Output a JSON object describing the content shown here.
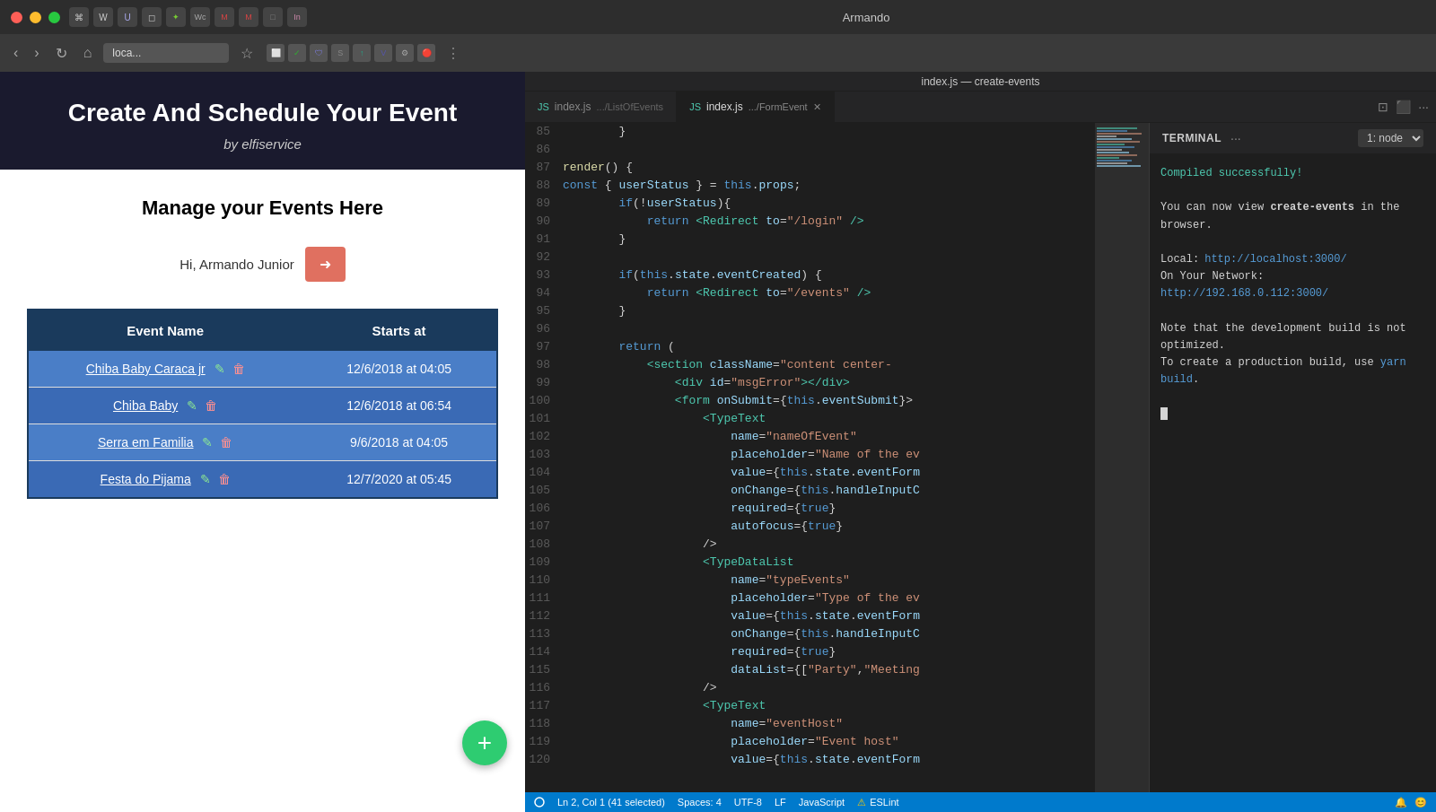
{
  "mac": {
    "titlebar_text": "Armando"
  },
  "browser": {
    "url": "loca...",
    "title": "Create And Schedule Your Event",
    "subtitle": "by elfiservice"
  },
  "app": {
    "manage_title": "Manage your Events Here",
    "user_greeting": "Hi, Armando Junior",
    "table": {
      "col_event": "Event Name",
      "col_starts": "Starts at",
      "rows": [
        {
          "name": "Chiba Baby Caraca jr",
          "starts": "12/6/2018 at 04:05"
        },
        {
          "name": "Chiba Baby",
          "starts": "12/6/2018 at 06:54"
        },
        {
          "name": "Serra em Familia",
          "starts": "9/6/2018 at 04:05"
        },
        {
          "name": "Festa do Pijama",
          "starts": "12/7/2020 at 05:45"
        }
      ]
    },
    "fab_label": "+"
  },
  "editor": {
    "window_title": "index.js — create-events",
    "tab1_label": "index.js",
    "tab1_path": ".../ListOfEvents",
    "tab2_label": "index.js",
    "tab2_path": ".../FormEvent",
    "lines": [
      {
        "num": "85",
        "code": "        }"
      },
      {
        "num": "86",
        "code": ""
      },
      {
        "num": "87",
        "code": "    render() {"
      },
      {
        "num": "88",
        "code": "        const { userStatus } = this.props;"
      },
      {
        "num": "89",
        "code": "        if(!userStatus){"
      },
      {
        "num": "90",
        "code": "            return <Redirect to=\"/login\" />"
      },
      {
        "num": "91",
        "code": "        }"
      },
      {
        "num": "92",
        "code": ""
      },
      {
        "num": "93",
        "code": "        if(this.state.eventCreated) {"
      },
      {
        "num": "94",
        "code": "            return <Redirect to=\"/events\" />"
      },
      {
        "num": "95",
        "code": "        }"
      },
      {
        "num": "96",
        "code": ""
      },
      {
        "num": "97",
        "code": "        return ("
      },
      {
        "num": "98",
        "code": "            <section className=\"content center-"
      },
      {
        "num": "99",
        "code": "                <div id=\"msgError\"></div>"
      },
      {
        "num": "100",
        "code": "                <form onSubmit={this.eventSubmit}>"
      },
      {
        "num": "101",
        "code": "                    <TypeText"
      },
      {
        "num": "102",
        "code": "                        name=\"nameOfEvent\""
      },
      {
        "num": "103",
        "code": "                        placeholder=\"Name of the ev"
      },
      {
        "num": "104",
        "code": "                        value={this.state.eventForm"
      },
      {
        "num": "105",
        "code": "                        onChange={this.handleInputC"
      },
      {
        "num": "106",
        "code": "                        required={true}"
      },
      {
        "num": "107",
        "code": "                        autofocus={true}"
      },
      {
        "num": "108",
        "code": "                    />"
      },
      {
        "num": "109",
        "code": "                    <TypeDataList"
      },
      {
        "num": "110",
        "code": "                        name=\"typeEvents\""
      },
      {
        "num": "111",
        "code": "                        placeholder=\"Type of the ev"
      },
      {
        "num": "112",
        "code": "                        value={this.state.eventForm"
      },
      {
        "num": "113",
        "code": "                        onChange={this.handleInputC"
      },
      {
        "num": "114",
        "code": "                        required={true}"
      },
      {
        "num": "115",
        "code": "                        dataList={[\"Party\",\"Meeting"
      },
      {
        "num": "116",
        "code": "                    />"
      },
      {
        "num": "117",
        "code": "                    <TypeText"
      },
      {
        "num": "118",
        "code": "                        name=\"eventHost\""
      },
      {
        "num": "119",
        "code": "                        placeholder=\"Event host\""
      },
      {
        "num": "120",
        "code": "                        value={this.state.eventForm"
      }
    ]
  },
  "terminal": {
    "title": "TERMINAL",
    "dropdown": "1: node",
    "success_msg": "Compiled successfully!",
    "body_text1": "You can now view ",
    "app_name": "create-events",
    "body_text2": " in the browser.",
    "local_label": "Local:",
    "local_url": "http://localhost:3000/",
    "network_label": "On Your Network:",
    "network_url": "http://192.168.0.112:3000/",
    "note_text": "Note that the development build is not optimized.",
    "production_text1": "To create a production build, use ",
    "yarn_cmd": "yarn build",
    "production_text2": "."
  },
  "statusbar": {
    "line_col": "Ln 2, Col 1 (41 selected)",
    "spaces": "Spaces: 4",
    "encoding": "UTF-8",
    "line_ending": "LF",
    "language": "JavaScript",
    "warning_label": "ESLint"
  }
}
